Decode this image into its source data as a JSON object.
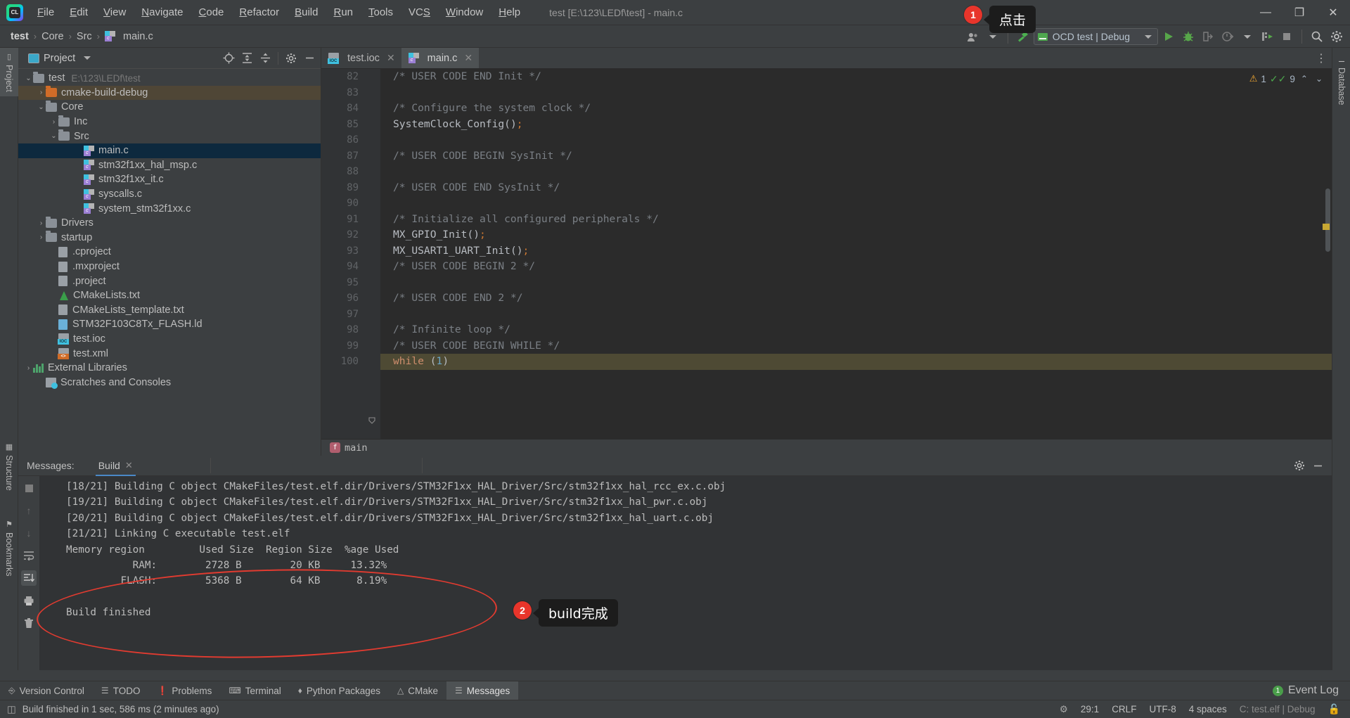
{
  "window": {
    "title": "test [E:\\123\\LEDf\\test] - main.c",
    "minimize": "—",
    "maximize": "❐",
    "close": "✕",
    "logo_text": "CL"
  },
  "menu": {
    "items": [
      "File",
      "Edit",
      "View",
      "Navigate",
      "Code",
      "Refactor",
      "Build",
      "Run",
      "Tools",
      "VCS",
      "Window",
      "Help"
    ]
  },
  "breadcrumbs": {
    "items": [
      "test",
      "Core",
      "Src",
      "main.c"
    ],
    "separator": "›"
  },
  "toolbar": {
    "run_config": "OCD test | Debug",
    "icons": [
      "user-avatar",
      "build-hammer",
      "run",
      "debug",
      "attach",
      "profile",
      "run-coverage",
      "stop",
      "search",
      "settings"
    ]
  },
  "left_tool_strip": {
    "tabs": [
      "Project",
      "Structure",
      "Bookmarks"
    ]
  },
  "right_tool_strip": {
    "tabs": [
      "Database"
    ]
  },
  "project_panel": {
    "title": "Project",
    "tools": [
      "locate-icon",
      "expand-all-icon",
      "collapse-all-icon",
      "settings-icon",
      "hide-icon"
    ],
    "tree": [
      {
        "label": "test",
        "sub": "E:\\123\\LEDf\\test",
        "indent": 0,
        "arrow": "⌄",
        "icon": "folder",
        "state": "normal"
      },
      {
        "label": "cmake-build-debug",
        "sub": "",
        "indent": 1,
        "arrow": "›",
        "icon": "folder-orange",
        "state": "highlight"
      },
      {
        "label": "Core",
        "sub": "",
        "indent": 1,
        "arrow": "⌄",
        "icon": "folder",
        "state": "normal"
      },
      {
        "label": "Inc",
        "sub": "",
        "indent": 2,
        "arrow": "›",
        "icon": "folder",
        "state": "normal"
      },
      {
        "label": "Src",
        "sub": "",
        "indent": 2,
        "arrow": "⌄",
        "icon": "folder",
        "state": "normal"
      },
      {
        "label": "main.c",
        "sub": "",
        "indent": 4,
        "arrow": "",
        "icon": "cfile",
        "state": "selected"
      },
      {
        "label": "stm32f1xx_hal_msp.c",
        "sub": "",
        "indent": 4,
        "arrow": "",
        "icon": "cfile",
        "state": "normal"
      },
      {
        "label": "stm32f1xx_it.c",
        "sub": "",
        "indent": 4,
        "arrow": "",
        "icon": "cfile",
        "state": "normal"
      },
      {
        "label": "syscalls.c",
        "sub": "",
        "indent": 4,
        "arrow": "",
        "icon": "cfile",
        "state": "normal"
      },
      {
        "label": "system_stm32f1xx.c",
        "sub": "",
        "indent": 4,
        "arrow": "",
        "icon": "cfile",
        "state": "normal"
      },
      {
        "label": "Drivers",
        "sub": "",
        "indent": 1,
        "arrow": "›",
        "icon": "folder",
        "state": "normal"
      },
      {
        "label": "startup",
        "sub": "",
        "indent": 1,
        "arrow": "›",
        "icon": "folder",
        "state": "normal"
      },
      {
        "label": ".cproject",
        "sub": "",
        "indent": 2,
        "arrow": "",
        "icon": "doc",
        "state": "normal"
      },
      {
        "label": ".mxproject",
        "sub": "",
        "indent": 2,
        "arrow": "",
        "icon": "doc",
        "state": "normal"
      },
      {
        "label": ".project",
        "sub": "",
        "indent": 2,
        "arrow": "",
        "icon": "doc",
        "state": "normal"
      },
      {
        "label": "CMakeLists.txt",
        "sub": "",
        "indent": 2,
        "arrow": "",
        "icon": "cmake",
        "state": "normal"
      },
      {
        "label": "CMakeLists_template.txt",
        "sub": "",
        "indent": 2,
        "arrow": "",
        "icon": "doc",
        "state": "normal"
      },
      {
        "label": "STM32F103C8Tx_FLASH.ld",
        "sub": "",
        "indent": 2,
        "arrow": "",
        "icon": "doc-blue",
        "state": "normal"
      },
      {
        "label": "test.ioc",
        "sub": "",
        "indent": 2,
        "arrow": "",
        "icon": "ioc",
        "state": "normal"
      },
      {
        "label": "test.xml",
        "sub": "",
        "indent": 2,
        "arrow": "",
        "icon": "xml",
        "state": "normal"
      },
      {
        "label": "External Libraries",
        "sub": "",
        "indent": 0,
        "arrow": "›",
        "icon": "libs",
        "state": "normal"
      },
      {
        "label": "Scratches and Consoles",
        "sub": "",
        "indent": 1,
        "arrow": "",
        "icon": "scratch",
        "state": "normal"
      }
    ]
  },
  "editor": {
    "tabs": [
      {
        "label": "test.ioc",
        "icon": "ioc-file-icon",
        "active": false
      },
      {
        "label": "main.c",
        "icon": "c-file-icon",
        "active": true
      }
    ],
    "inspection": {
      "warning_count": "1",
      "ok_count": "9",
      "up_arrow": "⌃",
      "down_arrow": "⌄"
    },
    "first_line_number": 82,
    "lines": [
      {
        "n": 82,
        "text": "/* USER CODE END Init */",
        "cls": "cmt",
        "indent": true
      },
      {
        "n": 83,
        "text": "",
        "cls": "cmt",
        "indent": true
      },
      {
        "n": 84,
        "text": "/* Configure the system clock */",
        "cls": "cmt",
        "indent": true
      },
      {
        "n": 85,
        "text": "SystemClock_Config();",
        "cls": "call",
        "indent": true
      },
      {
        "n": 86,
        "text": "",
        "cls": "cmt",
        "indent": true
      },
      {
        "n": 87,
        "text": "/* USER CODE BEGIN SysInit */",
        "cls": "cmt",
        "indent": true
      },
      {
        "n": 88,
        "text": "",
        "cls": "cmt",
        "indent": true
      },
      {
        "n": 89,
        "text": "/* USER CODE END SysInit */",
        "cls": "cmt",
        "indent": true
      },
      {
        "n": 90,
        "text": "",
        "cls": "cmt",
        "indent": true
      },
      {
        "n": 91,
        "text": "/* Initialize all configured peripherals */",
        "cls": "cmt",
        "indent": true
      },
      {
        "n": 92,
        "text": "MX_GPIO_Init();",
        "cls": "call",
        "indent": true
      },
      {
        "n": 93,
        "text": "MX_USART1_UART_Init();",
        "cls": "call",
        "indent": true
      },
      {
        "n": 94,
        "text": "/* USER CODE BEGIN 2 */",
        "cls": "cmt",
        "indent": true
      },
      {
        "n": 95,
        "text": "",
        "cls": "cmt",
        "indent": true
      },
      {
        "n": 96,
        "text": "/* USER CODE END 2 */",
        "cls": "cmt",
        "indent": true
      },
      {
        "n": 97,
        "text": "",
        "cls": "cmt",
        "indent": true
      },
      {
        "n": 98,
        "text": "/* Infinite loop */",
        "cls": "cmt",
        "indent": true
      },
      {
        "n": 99,
        "text": "/* USER CODE BEGIN WHILE */",
        "cls": "cmt",
        "indent": true
      },
      {
        "n": 100,
        "text": "while (1)",
        "cls": "while",
        "indent": true
      }
    ],
    "status_breadcrumb": "main",
    "status_breadcrumb_badge": "f"
  },
  "messages_panel": {
    "label": "Messages:",
    "tab": "Build",
    "tab_close": "✕",
    "tools": [
      "stop-icon",
      "up-arrow-icon",
      "down-arrow-icon",
      "wrap-text-icon",
      "sort-icon",
      "print-icon",
      "trash-icon"
    ],
    "header_right": [
      "settings-icon",
      "hide-icon"
    ],
    "output": [
      "[18/21] Building C object CMakeFiles/test.elf.dir/Drivers/STM32F1xx_HAL_Driver/Src/stm32f1xx_hal_rcc_ex.c.obj",
      "[19/21] Building C object CMakeFiles/test.elf.dir/Drivers/STM32F1xx_HAL_Driver/Src/stm32f1xx_hal_pwr.c.obj",
      "[20/21] Building C object CMakeFiles/test.elf.dir/Drivers/STM32F1xx_HAL_Driver/Src/stm32f1xx_hal_uart.c.obj",
      "[21/21] Linking C executable test.elf",
      "Memory region         Used Size  Region Size  %age Used",
      "           RAM:        2728 B        20 KB     13.32%",
      "         FLASH:        5368 B        64 KB      8.19%",
      "",
      "Build finished"
    ]
  },
  "annotations": [
    {
      "number": "1",
      "text": "点击"
    },
    {
      "number": "2",
      "text": "build完成"
    }
  ],
  "bottom_tabs": [
    {
      "label": "Version Control",
      "icon": "branch-icon",
      "active": false
    },
    {
      "label": "TODO",
      "icon": "list-icon",
      "active": false
    },
    {
      "label": "Problems",
      "icon": "exclamation-icon",
      "active": false
    },
    {
      "label": "Terminal",
      "icon": "terminal-icon",
      "active": false
    },
    {
      "label": "Python Packages",
      "icon": "layers-icon",
      "active": false
    },
    {
      "label": "CMake",
      "icon": "triangle-icon",
      "active": false
    },
    {
      "label": "Messages",
      "icon": "messages-icon",
      "active": true
    }
  ],
  "event_log": {
    "count": "1",
    "label": "Event Log"
  },
  "statusbar": {
    "message": "Build finished in 1 sec, 586 ms (2 minutes ago)",
    "caret": "29:1",
    "line_separator": "CRLF",
    "encoding": "UTF-8",
    "indent": "4 spaces",
    "config": "C: test.elf | Debug",
    "lock_icon": "🔓"
  },
  "colors": {
    "accent_red": "#e8352b",
    "panel_bg": "#3c3f41",
    "editor_bg": "#2b2b2b",
    "gutter_bg": "#313335",
    "selection": "#0d293e",
    "highlight_line": "#4e4a34"
  }
}
